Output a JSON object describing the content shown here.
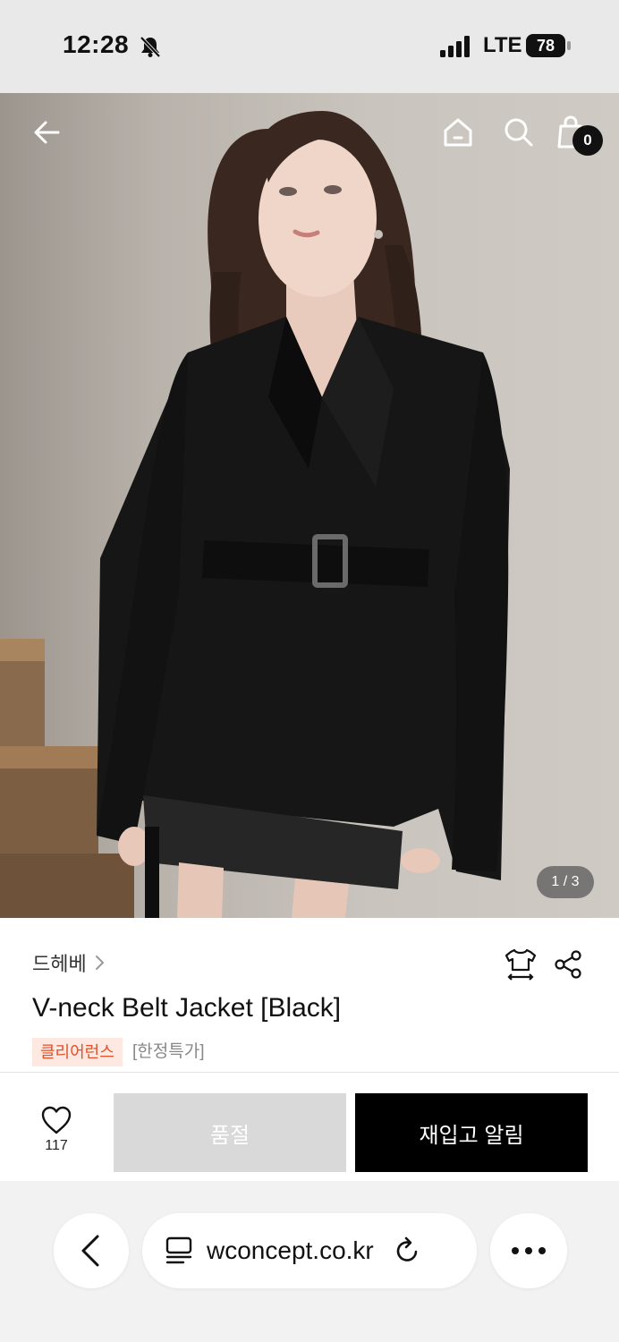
{
  "status_bar": {
    "time": "12:28",
    "network": "LTE",
    "battery": "78",
    "icons": [
      "bell-muted-icon",
      "signal-icon"
    ]
  },
  "header": {
    "icons": [
      "back-arrow-icon",
      "home-icon",
      "search-icon",
      "cart-icon"
    ],
    "cart_count": "0"
  },
  "gallery": {
    "counter": "1 / 3"
  },
  "product": {
    "brand": "드헤베",
    "title": "V-neck Belt Jacket [Black]",
    "tags": [
      "클리어런스",
      "[한정특가]"
    ],
    "icons": [
      "size-guide-icon",
      "share-icon"
    ]
  },
  "actions": {
    "like_count": "117",
    "sold_out_label": "품절",
    "notify_label": "재입고 알림"
  },
  "browser": {
    "url": "wconcept.co.kr",
    "icons": [
      "back-chevron-icon",
      "tabs-icon",
      "reload-icon",
      "more-icon"
    ]
  },
  "colors": {
    "accent_tag_bg": "#fde9e2",
    "accent_tag_text": "#e0522b",
    "primary_button": "#000000",
    "disabled_button": "#d9d9d9"
  }
}
